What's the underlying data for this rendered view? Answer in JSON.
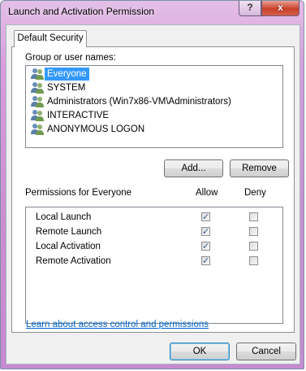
{
  "window": {
    "title": "Launch and Activation Permission",
    "help_label": "?",
    "close_label": "x"
  },
  "tab": {
    "label": "Default Security"
  },
  "group_section": {
    "label": "Group or user names:",
    "items": [
      {
        "label": "Everyone",
        "selected": true
      },
      {
        "label": "SYSTEM",
        "selected": false
      },
      {
        "label": "Administrators (Win7x86-VM\\Administrators)",
        "selected": false
      },
      {
        "label": "INTERACTIVE",
        "selected": false
      },
      {
        "label": "ANONYMOUS LOGON",
        "selected": false
      }
    ],
    "add_label": "Add...",
    "remove_label": "Remove"
  },
  "permissions": {
    "label": "Permissions for Everyone",
    "allow_header": "Allow",
    "deny_header": "Deny",
    "rows": [
      {
        "name": "Local Launch",
        "allow": true,
        "deny": false
      },
      {
        "name": "Remote Launch",
        "allow": true,
        "deny": false
      },
      {
        "name": "Local Activation",
        "allow": true,
        "deny": false
      },
      {
        "name": "Remote Activation",
        "allow": true,
        "deny": false
      }
    ]
  },
  "learn_link": "Learn about access control and permissions",
  "footer": {
    "ok_label": "OK",
    "cancel_label": "Cancel"
  },
  "colors": {
    "title_gradient": "#d99ddd",
    "selection": "#3399ff",
    "link": "#0066cc"
  }
}
